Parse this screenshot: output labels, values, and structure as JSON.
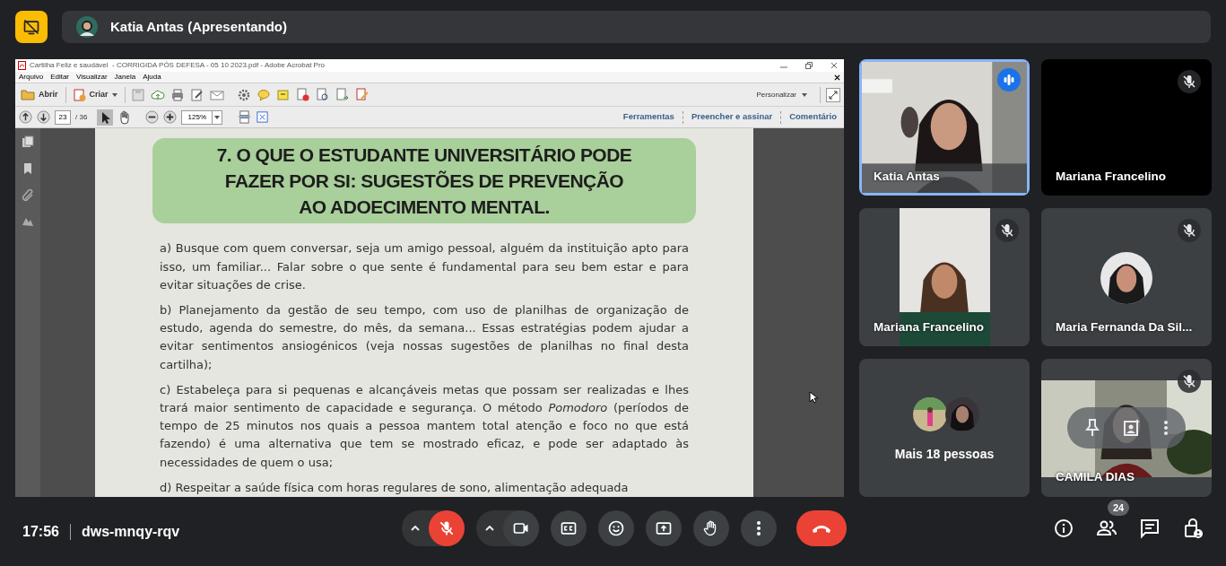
{
  "top_bar": {
    "presenter": "Katia Antas (Apresentando)"
  },
  "shared_screen": {
    "window_title": "Cartilha Feliz e saudável  - CORRIGIDA PÓS DEFESA - 05 10 2023.pdf - Adobe Acrobat Pro",
    "menu": [
      "Arquivo",
      "Editar",
      "Visualizar",
      "Janela",
      "Ajuda"
    ],
    "open_label": "Abrir",
    "create_label": "Criar",
    "customize_label": "Personalizar",
    "page_field": "23",
    "page_total": "/ 36",
    "zoom": "125%",
    "panels": [
      "Ferramentas",
      "Preencher e assinar",
      "Comentário"
    ],
    "document": {
      "heading_lines": [
        "7. O QUE O ESTUDANTE UNIVERSITÁRIO PODE",
        "FAZER POR SI: SUGESTÕES DE PREVENÇÃO",
        "AO ADOECIMENTO MENTAL."
      ],
      "paragraphs": [
        "a) Busque com quem conversar, seja um amigo pessoal, alguém da instituição apto para isso, um familiar... Falar sobre o que sente é fundamental para seu bem estar e para evitar situações de crise.",
        "b) Planejamento da gestão de seu tempo, com uso de planilhas de organização de estudo, agenda do semestre, do mês, da semana... Essas estratégias podem ajudar a evitar sentimentos ansiogénicos (veja nossas sugestões de planilhas no final desta cartilha);",
        "c) Estabeleça para si pequenas e alcançáveis metas que possam ser realizadas e lhes trará maior sentimento de capacidade e segurança. O método *Pomodoro* (períodos de tempo de 25 minutos nos quais a pessoa mantem total atenção e foco no que está fazendo) é uma alternativa que tem se mostrado eficaz, e pode ser adaptado às necessidades de quem o usa;",
        "d) Respeitar a saúde física com horas regulares de sono, alimentação adequada"
      ]
    }
  },
  "tiles": [
    {
      "kind": "video",
      "name": "Katia Antas",
      "speaking": true,
      "muted": false
    },
    {
      "kind": "no_video",
      "name": "Mariana Francelino",
      "speaking": false,
      "muted": true
    },
    {
      "kind": "portrait",
      "name": "Mariana Francelino",
      "speaking": false,
      "muted": true
    },
    {
      "kind": "avatar",
      "name": "Maria Fernanda Da Sil...",
      "speaking": false,
      "muted": true
    },
    {
      "kind": "more",
      "name": "Mais 18 pessoas"
    },
    {
      "kind": "band",
      "name": "CAMILA DIAS",
      "speaking": false,
      "muted": true,
      "hover_controls": true
    }
  ],
  "bottom_bar": {
    "time": "17:56",
    "meeting_code": "dws-mnqy-rqv",
    "mic_muted": true,
    "participants_count": "24"
  }
}
